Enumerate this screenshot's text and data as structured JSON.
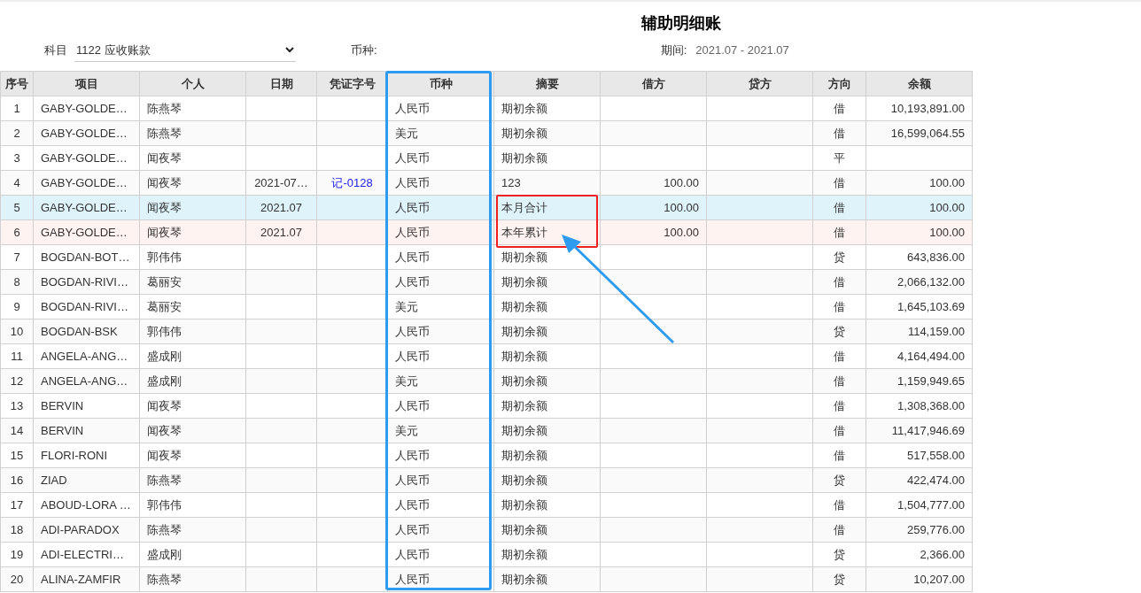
{
  "title": "辅助明细账",
  "filters": {
    "subject_label": "科目",
    "subject_value": "1122 应收账款",
    "currency_label": "币种:",
    "period_label": "期间:",
    "period_value": "2021.07 - 2021.07"
  },
  "table": {
    "columns": [
      "序号",
      "项目",
      "个人",
      "日期",
      "凭证字号",
      "币种",
      "摘要",
      "借方",
      "贷方",
      "方向",
      "余额"
    ],
    "rows": [
      {
        "kind": "normal",
        "cells": {
          "0": "1",
          "1": "GABY-GOLDE…",
          "2": "陈燕琴",
          "5": "人民币",
          "6": "期初余额",
          "9": "借",
          "10": "10,193,891.00"
        }
      },
      {
        "kind": "normal",
        "cells": {
          "0": "2",
          "1": "GABY-GOLDE…",
          "2": "陈燕琴",
          "5": "美元",
          "6": "期初余额",
          "9": "借",
          "10": "16,599,064.55"
        }
      },
      {
        "kind": "normal",
        "cells": {
          "0": "3",
          "1": "GABY-GOLDE…",
          "2": "闻夜琴",
          "5": "人民币",
          "6": "期初余额",
          "9": "平"
        }
      },
      {
        "kind": "normal",
        "cells": {
          "0": "4",
          "1": "GABY-GOLDE…",
          "2": "闻夜琴",
          "3": "2021-07…",
          "4": "记-0128",
          "5": "人民币",
          "6": "123",
          "7": "100.00",
          "9": "借",
          "10": "100.00"
        }
      },
      {
        "kind": "month_total",
        "cells": {
          "0": "5",
          "1": "GABY-GOLDE…",
          "2": "闻夜琴",
          "3": "2021.07",
          "5": "人民币",
          "6": "本月合计",
          "7": "100.00",
          "9": "借",
          "10": "100.00"
        }
      },
      {
        "kind": "year_total",
        "cells": {
          "0": "6",
          "1": "GABY-GOLDE…",
          "2": "闻夜琴",
          "3": "2021.07",
          "5": "人民币",
          "6": "本年累计",
          "7": "100.00",
          "9": "借",
          "10": "100.00"
        }
      },
      {
        "kind": "normal",
        "cells": {
          "0": "7",
          "1": "BOGDAN-BOT…",
          "2": "郭伟伟",
          "5": "人民币",
          "6": "期初余额",
          "9": "贷",
          "10": "643,836.00"
        }
      },
      {
        "kind": "normal",
        "cells": {
          "0": "8",
          "1": "BOGDAN-RIVI…",
          "2": "葛丽安",
          "5": "人民币",
          "6": "期初余额",
          "9": "借",
          "10": "2,066,132.00"
        }
      },
      {
        "kind": "normal",
        "cells": {
          "0": "9",
          "1": "BOGDAN-RIVI…",
          "2": "葛丽安",
          "5": "美元",
          "6": "期初余额",
          "9": "借",
          "10": "1,645,103.69"
        }
      },
      {
        "kind": "normal",
        "cells": {
          "0": "10",
          "1": "BOGDAN-BSK",
          "2": "郭伟伟",
          "5": "人民币",
          "6": "期初余额",
          "9": "贷",
          "10": "114,159.00"
        }
      },
      {
        "kind": "normal",
        "cells": {
          "0": "11",
          "1": "ANGELA-ANG…",
          "2": "盛成刚",
          "5": "人民币",
          "6": "期初余额",
          "9": "借",
          "10": "4,164,494.00"
        }
      },
      {
        "kind": "normal",
        "cells": {
          "0": "12",
          "1": "ANGELA-ANG…",
          "2": "盛成刚",
          "5": "美元",
          "6": "期初余额",
          "9": "借",
          "10": "1,159,949.65"
        }
      },
      {
        "kind": "normal",
        "cells": {
          "0": "13",
          "1": "BERVIN",
          "2": "闻夜琴",
          "5": "人民币",
          "6": "期初余额",
          "9": "借",
          "10": "1,308,368.00"
        }
      },
      {
        "kind": "normal",
        "cells": {
          "0": "14",
          "1": "BERVIN",
          "2": "闻夜琴",
          "5": "美元",
          "6": "期初余额",
          "9": "借",
          "10": "11,417,946.69"
        }
      },
      {
        "kind": "normal",
        "cells": {
          "0": "15",
          "1": "FLORI-RONI",
          "2": "闻夜琴",
          "5": "人民币",
          "6": "期初余额",
          "9": "借",
          "10": "517,558.00"
        }
      },
      {
        "kind": "normal",
        "cells": {
          "0": "16",
          "1": "ZIAD",
          "2": "陈燕琴",
          "5": "人民币",
          "6": "期初余额",
          "9": "贷",
          "10": "422,474.00"
        }
      },
      {
        "kind": "normal",
        "cells": {
          "0": "17",
          "1": "ABOUD-LORA …",
          "2": "郭伟伟",
          "5": "人民币",
          "6": "期初余额",
          "9": "借",
          "10": "1,504,777.00"
        }
      },
      {
        "kind": "normal",
        "cells": {
          "0": "18",
          "1": "ADI-PARADOX",
          "2": "陈燕琴",
          "5": "人民币",
          "6": "期初余额",
          "9": "借",
          "10": "259,776.00"
        }
      },
      {
        "kind": "normal",
        "cells": {
          "0": "19",
          "1": "ADI-ELECTRI…",
          "2": "盛成刚",
          "5": "人民币",
          "6": "期初余额",
          "9": "贷",
          "10": "2,366.00"
        }
      },
      {
        "kind": "normal",
        "cells": {
          "0": "20",
          "1": "ALINA-ZAMFIR",
          "2": "陈燕琴",
          "5": "人民币",
          "6": "期初余额",
          "9": "贷",
          "10": "10,207.00"
        }
      }
    ]
  }
}
